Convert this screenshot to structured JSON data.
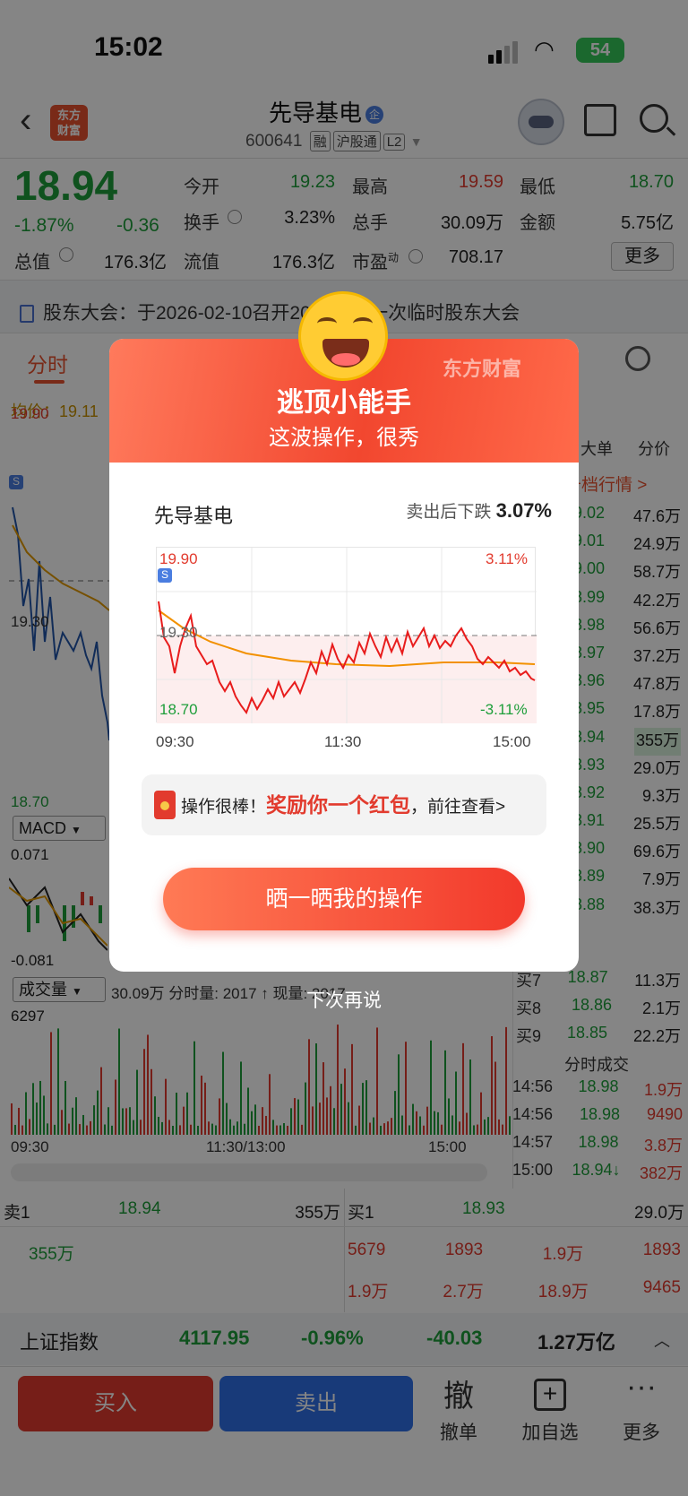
{
  "status_bar": {
    "time": "15:02",
    "battery": "54"
  },
  "header": {
    "title": "先导基电",
    "title_badge": "企",
    "code": "600641",
    "tags": [
      "融",
      "沪股通",
      "L2"
    ]
  },
  "quote": {
    "price": "18.94",
    "change_pct": "-1.87%",
    "change": "-0.36",
    "rows": [
      [
        {
          "label": "今开",
          "value": "19.23",
          "color": "green"
        },
        {
          "label": "最高",
          "value": "19.59",
          "color": "red"
        },
        {
          "label": "最低",
          "value": "18.70",
          "color": "green"
        }
      ],
      [
        {
          "label": "换手",
          "value": "3.23%",
          "color": "dark"
        },
        {
          "label": "总手",
          "value": "30.09万",
          "color": "dark"
        },
        {
          "label": "金额",
          "value": "5.75亿",
          "color": "dark"
        }
      ],
      [
        {
          "label": "流值",
          "value": "176.3亿",
          "color": "dark"
        },
        {
          "label": "市盈",
          "value": "708.17",
          "color": "dark"
        }
      ]
    ],
    "total_value_label": "总值",
    "total_value": "176.3亿",
    "pe_suffix": "动",
    "more": "更多"
  },
  "notice": "股东大会：于2026-02-10召开2026年第一次临时股东大会",
  "tabs": {
    "active": "分时"
  },
  "chart_area": {
    "avg_label": "均价：19.11",
    "y_top": "19.90",
    "y_mid": "19.30",
    "y_bottom": "18.70",
    "macd_label": "MACD",
    "macd_top": "0.071",
    "macd_bottom": "-0.081",
    "volume_label": "成交量",
    "volume_info": "30.09万 分时量: 2017 ↑ 现量: 2017",
    "volume_max": "6297",
    "x_labels": [
      "09:30",
      "11:30/13:00",
      "15:00"
    ]
  },
  "order_book": {
    "tabs": [
      "大单",
      "分价"
    ],
    "link": "千档行情 >",
    "rows": [
      {
        "price": "9.02",
        "vol": "47.6万"
      },
      {
        "price": "9.01",
        "vol": "24.9万"
      },
      {
        "price": "9.00",
        "vol": "58.7万"
      },
      {
        "price": "8.99",
        "vol": "42.2万"
      },
      {
        "price": "8.98",
        "vol": "56.6万"
      },
      {
        "price": "8.97",
        "vol": "37.2万"
      },
      {
        "price": "8.96",
        "vol": "47.8万"
      },
      {
        "price": "8.95",
        "vol": "17.8万"
      },
      {
        "price": "8.94",
        "vol": "355万"
      },
      {
        "price": "8.93",
        "vol": "29.0万"
      },
      {
        "price": "8.92",
        "vol": "9.3万"
      },
      {
        "price": "8.91",
        "vol": "25.5万"
      },
      {
        "price": "8.90",
        "vol": "69.6万"
      },
      {
        "price": "8.89",
        "vol": "7.9万"
      },
      {
        "price": "8.88",
        "vol": "38.3万"
      }
    ],
    "buy_rows": [
      {
        "label": "买7",
        "price": "18.87",
        "vol": "11.3万"
      },
      {
        "label": "买8",
        "price": "18.86",
        "vol": "2.1万"
      },
      {
        "label": "买9",
        "price": "18.85",
        "vol": "22.2万"
      }
    ],
    "ticks_title": "分时成交",
    "ticks": [
      {
        "time": "14:56",
        "price": "18.98",
        "vol": "1.9万"
      },
      {
        "time": "14:56",
        "price": "18.98",
        "vol": "9490"
      },
      {
        "time": "14:57",
        "price": "18.98",
        "vol": "3.8万"
      },
      {
        "time": "15:00",
        "price": "18.94↓",
        "vol": "382万"
      }
    ]
  },
  "bottom": {
    "sell1_label": "卖1",
    "sell1_price": "18.94",
    "sell1_vol": "355万",
    "buy1_label": "买1",
    "buy1_price": "18.93",
    "buy1_vol": "29.0万",
    "left_vol": "355万",
    "right_row1": [
      "5679",
      "1893",
      "1.9万",
      "1893"
    ],
    "right_row2": [
      "1.9万",
      "2.7万",
      "18.9万",
      "9465"
    ]
  },
  "index_bar": {
    "name": "上证指数",
    "value": "4117.95",
    "pct": "-0.96%",
    "change": "-40.03",
    "amount": "1.27万亿"
  },
  "footer": {
    "buy": "买入",
    "sell": "卖出",
    "cancel_icon": "撤",
    "cancel": "撤单",
    "add": "加自选",
    "more": "更多"
  },
  "modal": {
    "brand": "东方财富",
    "title": "逃顶小能手",
    "subtitle": "这波操作，很秀",
    "stock": "先导基电",
    "drop_label": "卖出后下跌",
    "drop_value": "3.07%",
    "chart_top": "19.90",
    "chart_top_pct": "3.11%",
    "chart_bottom": "18.70",
    "chart_bottom_pct": "-3.11%",
    "chart_mid": "19.30",
    "chart_x": [
      "09:30",
      "11:30",
      "15:00"
    ],
    "reward_prefix": "操作很棒！",
    "reward_highlight": "奖励你一个红包",
    "reward_suffix": "，前往查看>",
    "share_button": "晒一晒我的操作",
    "later": "下次再说"
  },
  "colors": {
    "up": "#e23b2e",
    "down": "#1e9e3a",
    "accent": "#e8522f",
    "buy": "#e23b2e",
    "sell": "#2f6fe8"
  },
  "icons": [
    "back-icon",
    "app-logo",
    "robot-avatar-icon",
    "share-icon",
    "search-icon",
    "gear-icon",
    "red-envelope-icon",
    "laughing-emoji-icon"
  ]
}
